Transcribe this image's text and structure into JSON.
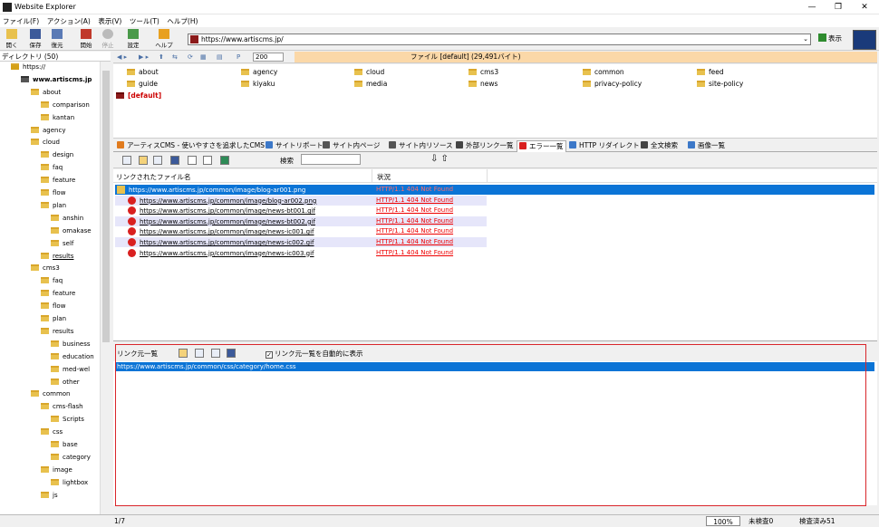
{
  "window": {
    "title": "Website Explorer",
    "controls": [
      "—",
      "❐",
      "✕"
    ]
  },
  "menu": [
    "ファイル(F)",
    "アクション(A)",
    "表示(V)",
    "ツール(T)",
    "ヘルプ(H)"
  ],
  "toolbar": {
    "buttons": [
      {
        "label": "開く",
        "icon": "open-folder-icon"
      },
      {
        "label": "保存",
        "icon": "save-icon"
      },
      {
        "label": "復元",
        "icon": "restore-icon"
      },
      {
        "label": "開始",
        "icon": "start-icon"
      },
      {
        "label": "停止",
        "icon": "stop-icon"
      },
      {
        "label": "設定",
        "icon": "settings-icon"
      },
      {
        "label": "ヘルプ",
        "icon": "help-icon"
      }
    ],
    "url": "https://www.artiscms.jp/",
    "go_label": "表示"
  },
  "directory": {
    "header": "ディレクトリ (50)",
    "items": [
      {
        "label": "https://",
        "depth": 0
      },
      {
        "label": "www.artiscms.jp",
        "depth": 1
      },
      {
        "label": "about",
        "depth": 2
      },
      {
        "label": "comparison",
        "depth": 3
      },
      {
        "label": "kantan",
        "depth": 3
      },
      {
        "label": "agency",
        "depth": 2
      },
      {
        "label": "cloud",
        "depth": 2
      },
      {
        "label": "design",
        "depth": 3
      },
      {
        "label": "faq",
        "depth": 3
      },
      {
        "label": "feature",
        "depth": 3
      },
      {
        "label": "flow",
        "depth": 3
      },
      {
        "label": "plan",
        "depth": 3
      },
      {
        "label": "anshin",
        "depth": 4
      },
      {
        "label": "omakase",
        "depth": 4
      },
      {
        "label": "self",
        "depth": 4
      },
      {
        "label": "results",
        "depth": 3
      },
      {
        "label": "cms3",
        "depth": 2
      },
      {
        "label": "faq",
        "depth": 3
      },
      {
        "label": "feature",
        "depth": 3
      },
      {
        "label": "flow",
        "depth": 3
      },
      {
        "label": "plan",
        "depth": 3
      },
      {
        "label": "results",
        "depth": 3
      },
      {
        "label": "business",
        "depth": 4
      },
      {
        "label": "education",
        "depth": 4
      },
      {
        "label": "med-wel",
        "depth": 4
      },
      {
        "label": "other",
        "depth": 4
      },
      {
        "label": "common",
        "depth": 2
      },
      {
        "label": "cms-flash",
        "depth": 3
      },
      {
        "label": "Scripts",
        "depth": 4
      },
      {
        "label": "css",
        "depth": 3
      },
      {
        "label": "base",
        "depth": 4
      },
      {
        "label": "category",
        "depth": 4
      },
      {
        "label": "image",
        "depth": 3
      },
      {
        "label": "lightbox",
        "depth": 4
      },
      {
        "label": "js",
        "depth": 3
      }
    ]
  },
  "navbar": {
    "zoom": "200",
    "file_info": "ファイル [default] (29,491バイト)"
  },
  "folders": [
    "about",
    "agency",
    "cloud",
    "cms3",
    "common",
    "feed",
    "guide",
    "kiyaku",
    "media",
    "news",
    "privacy-policy",
    "site-policy"
  ],
  "default_folder": "[default]",
  "tabs": [
    {
      "label": "アーティスCMS - 使いやすさを追求したCMS",
      "color": "#e07b1e"
    },
    {
      "label": "サイトリポート",
      "color": "#3c78c8"
    },
    {
      "label": "サイト内ページ",
      "color": "#555555"
    },
    {
      "label": "サイト内リソース",
      "color": "#555555"
    },
    {
      "label": "外部リンク一覧",
      "color": "#444444"
    },
    {
      "label": "エラー一覧",
      "color": "#d92020"
    },
    {
      "label": "HTTP リダイレクト",
      "color": "#3c78c8"
    },
    {
      "label": "全文検索",
      "color": "#444444"
    },
    {
      "label": "画像一覧",
      "color": "#3c78c8"
    }
  ],
  "search_label": "検索",
  "errors": {
    "columns": [
      "リンクされたファイル名",
      "状況"
    ],
    "rows": [
      {
        "file": "https://www.artiscms.jp/common/image/blog-ar001.png",
        "status": "HTTP/1.1 404 Not Found"
      },
      {
        "file": "https://www.artiscms.jp/common/image/blog-ar002.png",
        "status": "HTTP/1.1 404 Not Found"
      },
      {
        "file": "https://www.artiscms.jp/common/image/news-bt001.gif",
        "status": "HTTP/1.1 404 Not Found"
      },
      {
        "file": "https://www.artiscms.jp/common/image/news-bt002.gif",
        "status": "HTTP/1.1 404 Not Found"
      },
      {
        "file": "https://www.artiscms.jp/common/image/news-ic001.gif",
        "status": "HTTP/1.1 404 Not Found"
      },
      {
        "file": "https://www.artiscms.jp/common/image/news-ic002.gif",
        "status": "HTTP/1.1 404 Not Found"
      },
      {
        "file": "https://www.artiscms.jp/common/image/news-ic003.gif",
        "status": "HTTP/1.1 404 Not Found"
      }
    ]
  },
  "reflist": {
    "title": "リンク元一覧",
    "auto_label": "リンク元一覧を自動的に表示",
    "selected": "https://www.artiscms.jp/common/css/category/home.css"
  },
  "status": {
    "count": "1/7",
    "zoom": "100%",
    "unchecked": "未検査0",
    "checked": "検査済み51"
  }
}
